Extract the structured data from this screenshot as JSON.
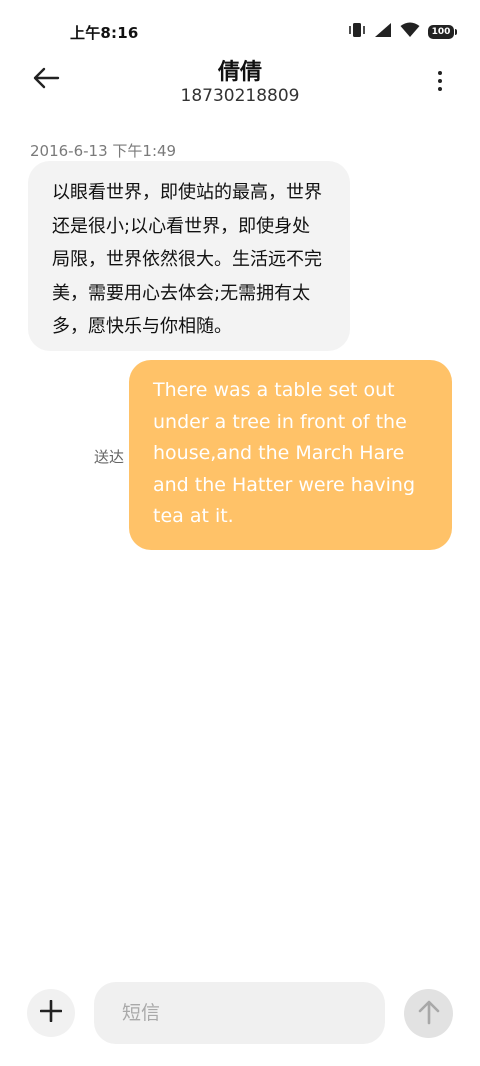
{
  "status_bar": {
    "time": "上午8:16",
    "battery": "100"
  },
  "header": {
    "title": "倩倩",
    "subtitle": "18730218809"
  },
  "messages": [
    {
      "direction": "incoming",
      "timestamp": "2016-6-13 下午1:49",
      "text": "以眼看世界，即使站的最高，世界还是很小;以心看世界，即使身处局限，世界依然很大。生活远不完美，需要用心去体会;无需拥有太多，愿快乐与你相随。"
    },
    {
      "direction": "outgoing",
      "status": "送达",
      "text": "There was a table set out under a tree in front of the house,and the March Hare and the Hatter were having tea at it."
    }
  ],
  "composer": {
    "placeholder": "短信",
    "value": ""
  },
  "colors": {
    "outgoing_bubble": "#ffc268",
    "incoming_bubble": "#f3f3f3"
  },
  "icons": {
    "back": "arrow-left-icon",
    "more": "more-vertical-icon",
    "add": "plus-icon",
    "send": "arrow-up-icon"
  }
}
